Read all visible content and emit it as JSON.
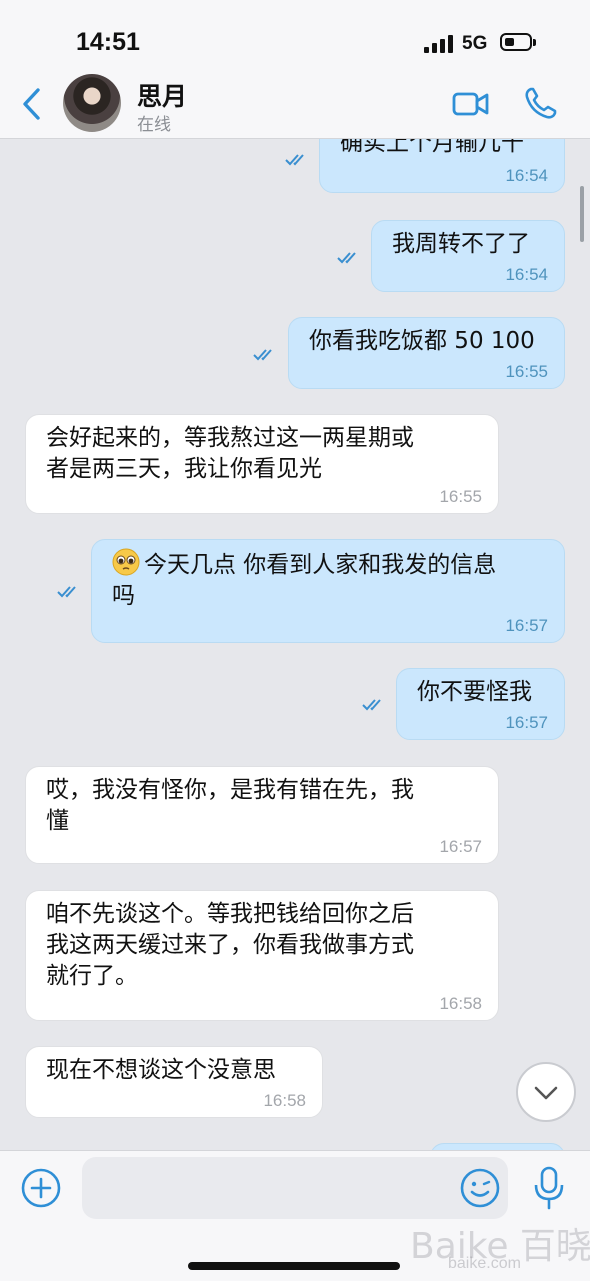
{
  "status_bar": {
    "time": "14:51",
    "network": "5G"
  },
  "header": {
    "contact_name": "思月",
    "presence": "在线"
  },
  "messages": [
    {
      "direction": "out",
      "text": "确实上个月输几千",
      "time": "16:54"
    },
    {
      "direction": "out",
      "text": "我周转不了了",
      "time": "16:54"
    },
    {
      "direction": "out",
      "text": "你看我吃饭都 50 100",
      "time": "16:55"
    },
    {
      "direction": "in",
      "text": "会好起来的，等我熬过这一两星期或\n者是两三天，我让你看见光",
      "time": "16:55"
    },
    {
      "direction": "out",
      "emoji": "pleading-face-icon",
      "text": "今天几点 你看到人家和我发的信息\n吗",
      "time": "16:57"
    },
    {
      "direction": "out",
      "text": "你不要怪我",
      "time": "16:57"
    },
    {
      "direction": "in",
      "text": "哎，我没有怪你，是我有错在先，我\n懂",
      "time": "16:57"
    },
    {
      "direction": "in",
      "text": "咱不先谈这个。等我把钱给回你之后\n我这两天缓过来了，你看我做事方式\n就行了。",
      "time": "16:58"
    },
    {
      "direction": "in",
      "text": "现在不想谈这个没意思",
      "time": "16:58"
    }
  ],
  "input": {
    "placeholder": ""
  },
  "watermark": {
    "text": "百晓头条",
    "url": "baike.com"
  },
  "colors": {
    "accent": "#2f8fd6",
    "outgoing_bubble": "#cbe7fd",
    "incoming_bubble": "#ffffff",
    "background": "#e6e7eb"
  }
}
